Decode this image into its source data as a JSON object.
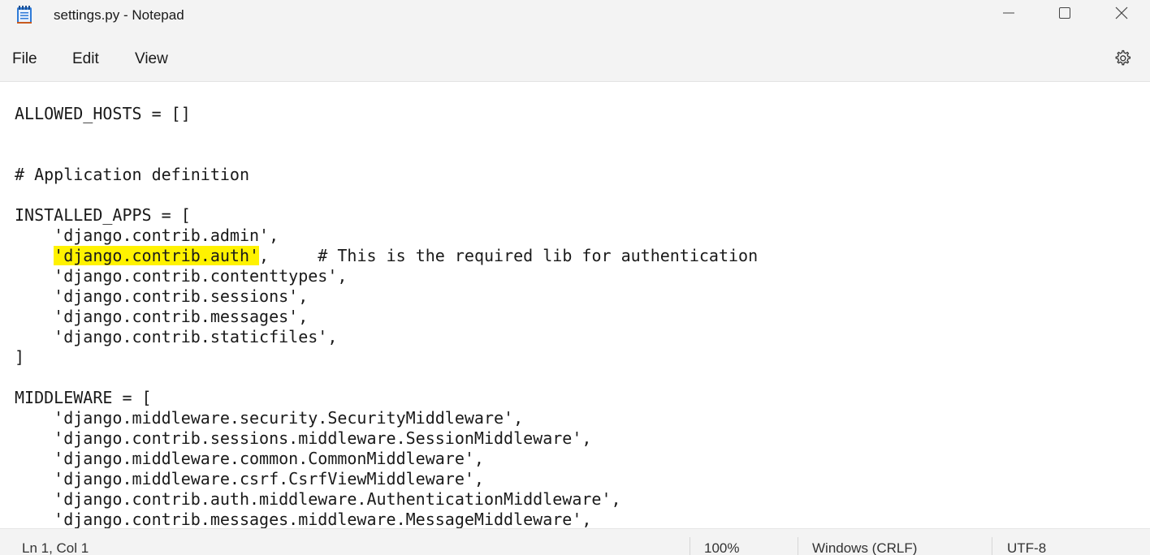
{
  "window": {
    "title": "settings.py - Notepad"
  },
  "menu": {
    "file": "File",
    "edit": "Edit",
    "view": "View"
  },
  "icons": {
    "app": "notepad-icon",
    "minimize": "minimize-icon",
    "maximize": "maximize-icon",
    "close": "close-icon",
    "settings": "gear-icon"
  },
  "colors": {
    "highlight": "#fff200",
    "chrome": "#f3f3f3",
    "accent": "#2f7bd8"
  },
  "editor": {
    "lines": [
      "",
      "ALLOWED_HOSTS = []",
      "",
      "",
      "# Application definition",
      "",
      "INSTALLED_APPS = [",
      "    'django.contrib.admin',",
      "    ",
      "    'django.contrib.contenttypes',",
      "    'django.contrib.sessions',",
      "    'django.contrib.messages',",
      "    'django.contrib.staticfiles',",
      "]",
      "",
      "MIDDLEWARE = [",
      "    'django.middleware.security.SecurityMiddleware',",
      "    'django.contrib.sessions.middleware.SessionMiddleware',",
      "    'django.middleware.common.CommonMiddleware',",
      "    'django.middleware.csrf.CsrfViewMiddleware',",
      "    'django.contrib.auth.middleware.AuthenticationMiddleware',",
      "    'django.contrib.messages.middleware.MessageMiddleware',"
    ],
    "highlighted_line": {
      "highlighted_text": "'django.contrib.auth'",
      "rest": ",     # This is the required lib for authentication"
    }
  },
  "status": {
    "position": "Ln 1, Col 1",
    "zoom": "100%",
    "line_ending": "Windows (CRLF)",
    "encoding": "UTF-8"
  }
}
